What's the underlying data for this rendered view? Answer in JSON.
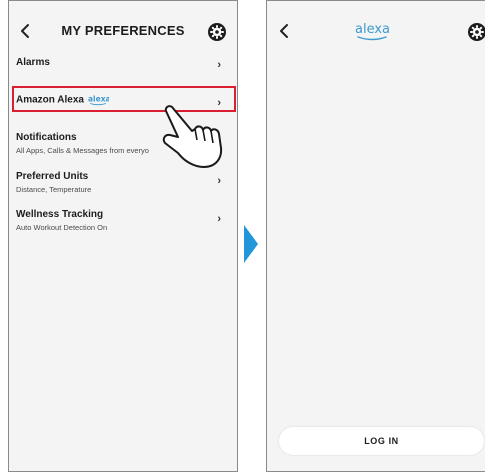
{
  "left_screen": {
    "header": {
      "back_icon": "chevron-left-icon",
      "title": "MY PREFERENCES",
      "settings_icon": "gear-icon"
    },
    "items": [
      {
        "title": "Alarms",
        "subtitle": ""
      },
      {
        "title": "Amazon Alexa",
        "logo": "alexa",
        "subtitle": ""
      },
      {
        "title": "Notifications",
        "subtitle": "All Apps, Calls & Messages from everyo"
      },
      {
        "title": "Preferred Units",
        "subtitle": "Distance, Temperature"
      },
      {
        "title": "Wellness Tracking",
        "subtitle": "Auto Workout Detection On"
      }
    ],
    "chevron_glyph": "›",
    "highlight_color": "#dc1e32",
    "pointer_icon": "hand-pointer-icon"
  },
  "transition_arrow": {
    "icon": "play-arrow-icon",
    "color": "#2196d9"
  },
  "right_screen": {
    "header": {
      "back_icon": "chevron-left-icon",
      "logo": "alexa",
      "settings_icon": "gear-icon"
    },
    "login_label": "LOG IN"
  }
}
